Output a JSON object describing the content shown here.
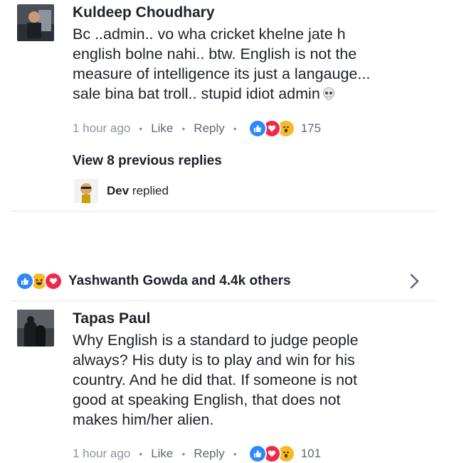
{
  "comment1": {
    "author": "Kuldeep Choudhary",
    "lines": [
      "Bc ..admin.. vo wha cricket khelne jate h",
      "english bolne nahi.. btw. English is not the",
      "measure of intelligence its just a langauge...",
      "sale bina bat troll.. stupid idiot admin"
    ],
    "emoji_icon": "skull-icon",
    "time": "1 hour ago",
    "like": "Like",
    "reply": "Reply",
    "reactions": [
      "like-icon",
      "love-icon",
      "wow-icon"
    ],
    "reaction_count": "175"
  },
  "replies": {
    "view_previous": "View 8 previous replies",
    "reply_author": "Dev",
    "reply_action": "replied"
  },
  "post_reactions": {
    "icons": [
      "like-icon",
      "haha-icon",
      "love-icon"
    ],
    "summary": "Yashwanth Gowda and 4.4k others",
    "chevron": "chevron-right-icon"
  },
  "comment2": {
    "author": "Tapas Paul",
    "lines": [
      "Why English is a standard to judge people",
      "always? His duty is to play and win for his",
      "country. And he did that. If someone is not",
      "good at speaking English, that does not",
      "makes him/her alien."
    ],
    "time": "1 hour ago",
    "like": "Like",
    "reply": "Reply",
    "reactions": [
      "like-icon",
      "love-icon",
      "wow-icon"
    ],
    "reaction_count": "101"
  },
  "colors": {
    "like": "#2d88ff",
    "love": "#f02849",
    "wow": "#f7b928",
    "meta_text": "#8d949e",
    "divider": "#e4e6eb"
  }
}
